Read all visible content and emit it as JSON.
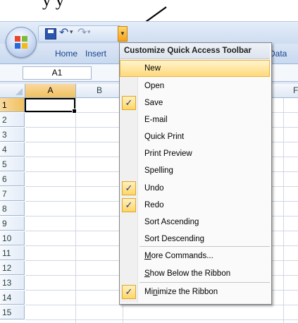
{
  "caption": "y        y",
  "app": {
    "tabs": [
      "Home",
      "Insert",
      "Data"
    ],
    "name_box": "A1",
    "columns": [
      "A",
      "B",
      "F"
    ],
    "rows": [
      "1",
      "2",
      "3",
      "4",
      "5",
      "6",
      "7",
      "8",
      "9",
      "10",
      "11",
      "12",
      "13",
      "14",
      "15"
    ],
    "active_cell": "A1"
  },
  "icons": {
    "office_button": "office-logo-icon",
    "save": "save-icon",
    "undo": "undo-icon",
    "redo": "redo-icon",
    "customize": "dropdown-arrow-icon"
  },
  "menu": {
    "title": "Customize Quick Access Toolbar",
    "items": [
      {
        "label": "New",
        "checked": false,
        "highlighted": true
      },
      {
        "label": "Open",
        "checked": false
      },
      {
        "label": "Save",
        "checked": true
      },
      {
        "label": "E-mail",
        "checked": false
      },
      {
        "label": "Quick Print",
        "checked": false
      },
      {
        "label": "Print Preview",
        "checked": false
      },
      {
        "label": "Spelling",
        "checked": false
      },
      {
        "label": "Undo",
        "checked": true
      },
      {
        "label": "Redo",
        "checked": true
      },
      {
        "label": "Sort Ascending",
        "checked": false
      },
      {
        "label": "Sort Descending",
        "checked": false
      },
      {
        "label_pre": "",
        "label_u": "M",
        "label_post": "ore Commands...",
        "checked": false
      },
      {
        "label_pre": "",
        "label_u": "S",
        "label_post": "how Below the Ribbon",
        "checked": false
      },
      {
        "label_pre": "Mi",
        "label_u": "n",
        "label_post": "imize the Ribbon",
        "checked": true
      }
    ],
    "check_glyph": "✓"
  },
  "colors": {
    "ribbon_blue": "#c9d9ef",
    "highlight": "#ffd97a",
    "check_bg": "#ffd566"
  }
}
